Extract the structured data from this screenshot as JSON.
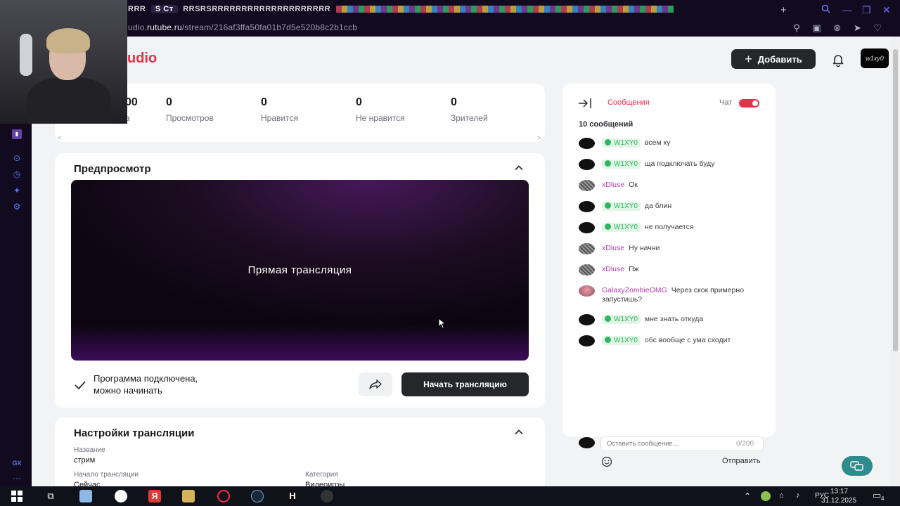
{
  "browser": {
    "active_tab": "S Ст",
    "tab_strip": "RRR",
    "tab_strip_tail": "RRSRSRRRRRRRRRRRRRRRRRRRR",
    "url_prefix": "udio.",
    "url_domain": "rutube.ru",
    "url_path": "/stream/216af3ffa50fa01b7d5e520b8c2b1ccb",
    "sidebar_bottom_label": "GX"
  },
  "header": {
    "logo": "udio",
    "add_button": "Добавить",
    "avatar_text": "w1xy0"
  },
  "stats": [
    {
      "num": "00",
      "label": "а"
    },
    {
      "num": "0",
      "label": "Просмотров"
    },
    {
      "num": "0",
      "label": "Нравится"
    },
    {
      "num": "0",
      "label": "Не нравится"
    },
    {
      "num": "0",
      "label": "Зрителей"
    }
  ],
  "preview": {
    "title": "Предпросмотр",
    "video_label": "Прямая трансляция",
    "status_line1": "Программа подключена,",
    "status_line2": "можно начинать",
    "start_button": "Начать трансляцию"
  },
  "settings": {
    "title": "Настройки трансляции",
    "name_label": "Название",
    "name_value": "стрим",
    "start_label": "Начало трансляции",
    "start_value": "Сейчас",
    "category_label": "Категория",
    "category_value": "Видеоигры"
  },
  "chat": {
    "tab": "Сообщения",
    "toggle_label": "Чат",
    "count": "10 сообщений",
    "messages": [
      {
        "author": "W1XY0",
        "text": "всем ку"
      },
      {
        "author": "W1XY0",
        "text": "ща подключать буду"
      },
      {
        "author": "xDluse",
        "text": "Ок"
      },
      {
        "author": "W1XY0",
        "text": "да блин"
      },
      {
        "author": "W1XY0",
        "text": "не получается"
      },
      {
        "author": "xDluse",
        "text": "Ну начни"
      },
      {
        "author": "xDluse",
        "text": "Пж"
      },
      {
        "author": "GalaxyZombieOMG",
        "text": "Через скок примерно запустишь?"
      },
      {
        "author": "W1XY0",
        "text": "мне знать откуда"
      },
      {
        "author": "W1XY0",
        "text": "обс вообще с ума сходит"
      }
    ],
    "input_placeholder": "Оставить сообщение...",
    "counter": "0/200",
    "send": "Отправить"
  },
  "taskbar": {
    "lang": "РУС",
    "time": "13:17",
    "date": "31.12.2025",
    "notif_count": "4"
  },
  "colors": {
    "accent": "#e8304b",
    "dark_button": "#26272b",
    "verified": "#30b45e"
  }
}
